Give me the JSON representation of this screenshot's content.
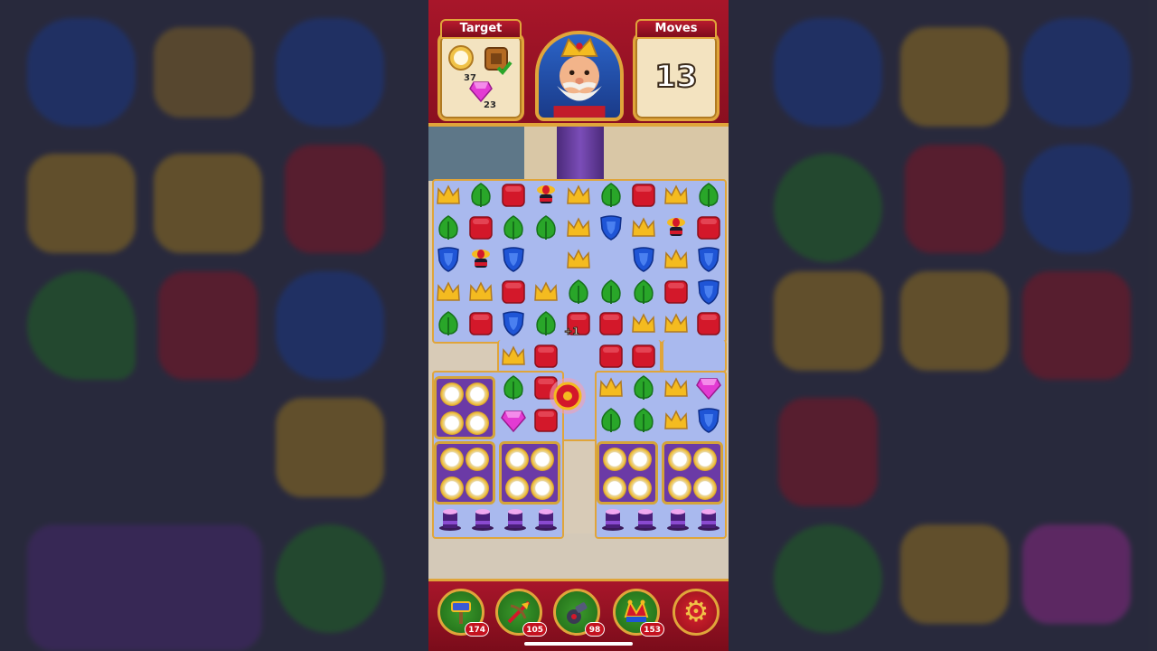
{
  "header": {
    "target_label": "Target",
    "moves_label": "Moves",
    "moves_value": "13",
    "targets": [
      {
        "icon": "plate-icon",
        "count": "37"
      },
      {
        "icon": "crate-icon",
        "done": true
      },
      {
        "icon": "gem-icon",
        "count": "23"
      }
    ]
  },
  "boosters": [
    {
      "name": "hammer-booster",
      "count": "174"
    },
    {
      "name": "arrow-booster",
      "count": "105"
    },
    {
      "name": "cannon-booster",
      "count": "98"
    },
    {
      "name": "jester-booster",
      "count": "153"
    }
  ],
  "colors": {
    "red": "#d3182a",
    "green": "#29a629",
    "blue": "#1f55d6",
    "yellow": "#f4bb20",
    "pink": "#e33bd3",
    "board_bg": "#a9b9ee",
    "frame_gold": "#e0a53a"
  },
  "board": {
    "rows": [
      [
        "crown",
        "leaf",
        "cube",
        "propeller",
        "crown",
        "leaf",
        "cube",
        "crown",
        "leaf"
      ],
      [
        "leaf",
        "cube",
        "leaf",
        "leaf",
        "crown",
        "shield",
        "crown",
        "propeller",
        "cube"
      ],
      [
        "shield",
        "propeller",
        "shield",
        "",
        "crown",
        "",
        "shield",
        "crown",
        "shield"
      ],
      [
        "crown",
        "crown",
        "cube",
        "crown",
        "leaf",
        "leaf",
        "leaf",
        "cube",
        "shield"
      ],
      [
        "leaf",
        "cube",
        "shield",
        "leaf",
        "cube",
        "cube",
        "crown",
        "crown",
        "cube"
      ],
      [
        "",
        "",
        "crown",
        "cube",
        "",
        "cube",
        "cube",
        "",
        ""
      ],
      [
        "",
        "",
        "leaf",
        "cube",
        "",
        "crown",
        "leaf",
        "crown",
        "gem"
      ],
      [
        "",
        "",
        "gem",
        "cube",
        "",
        "leaf",
        "leaf",
        "crown",
        "shield"
      ]
    ],
    "popup_text": "+1"
  }
}
